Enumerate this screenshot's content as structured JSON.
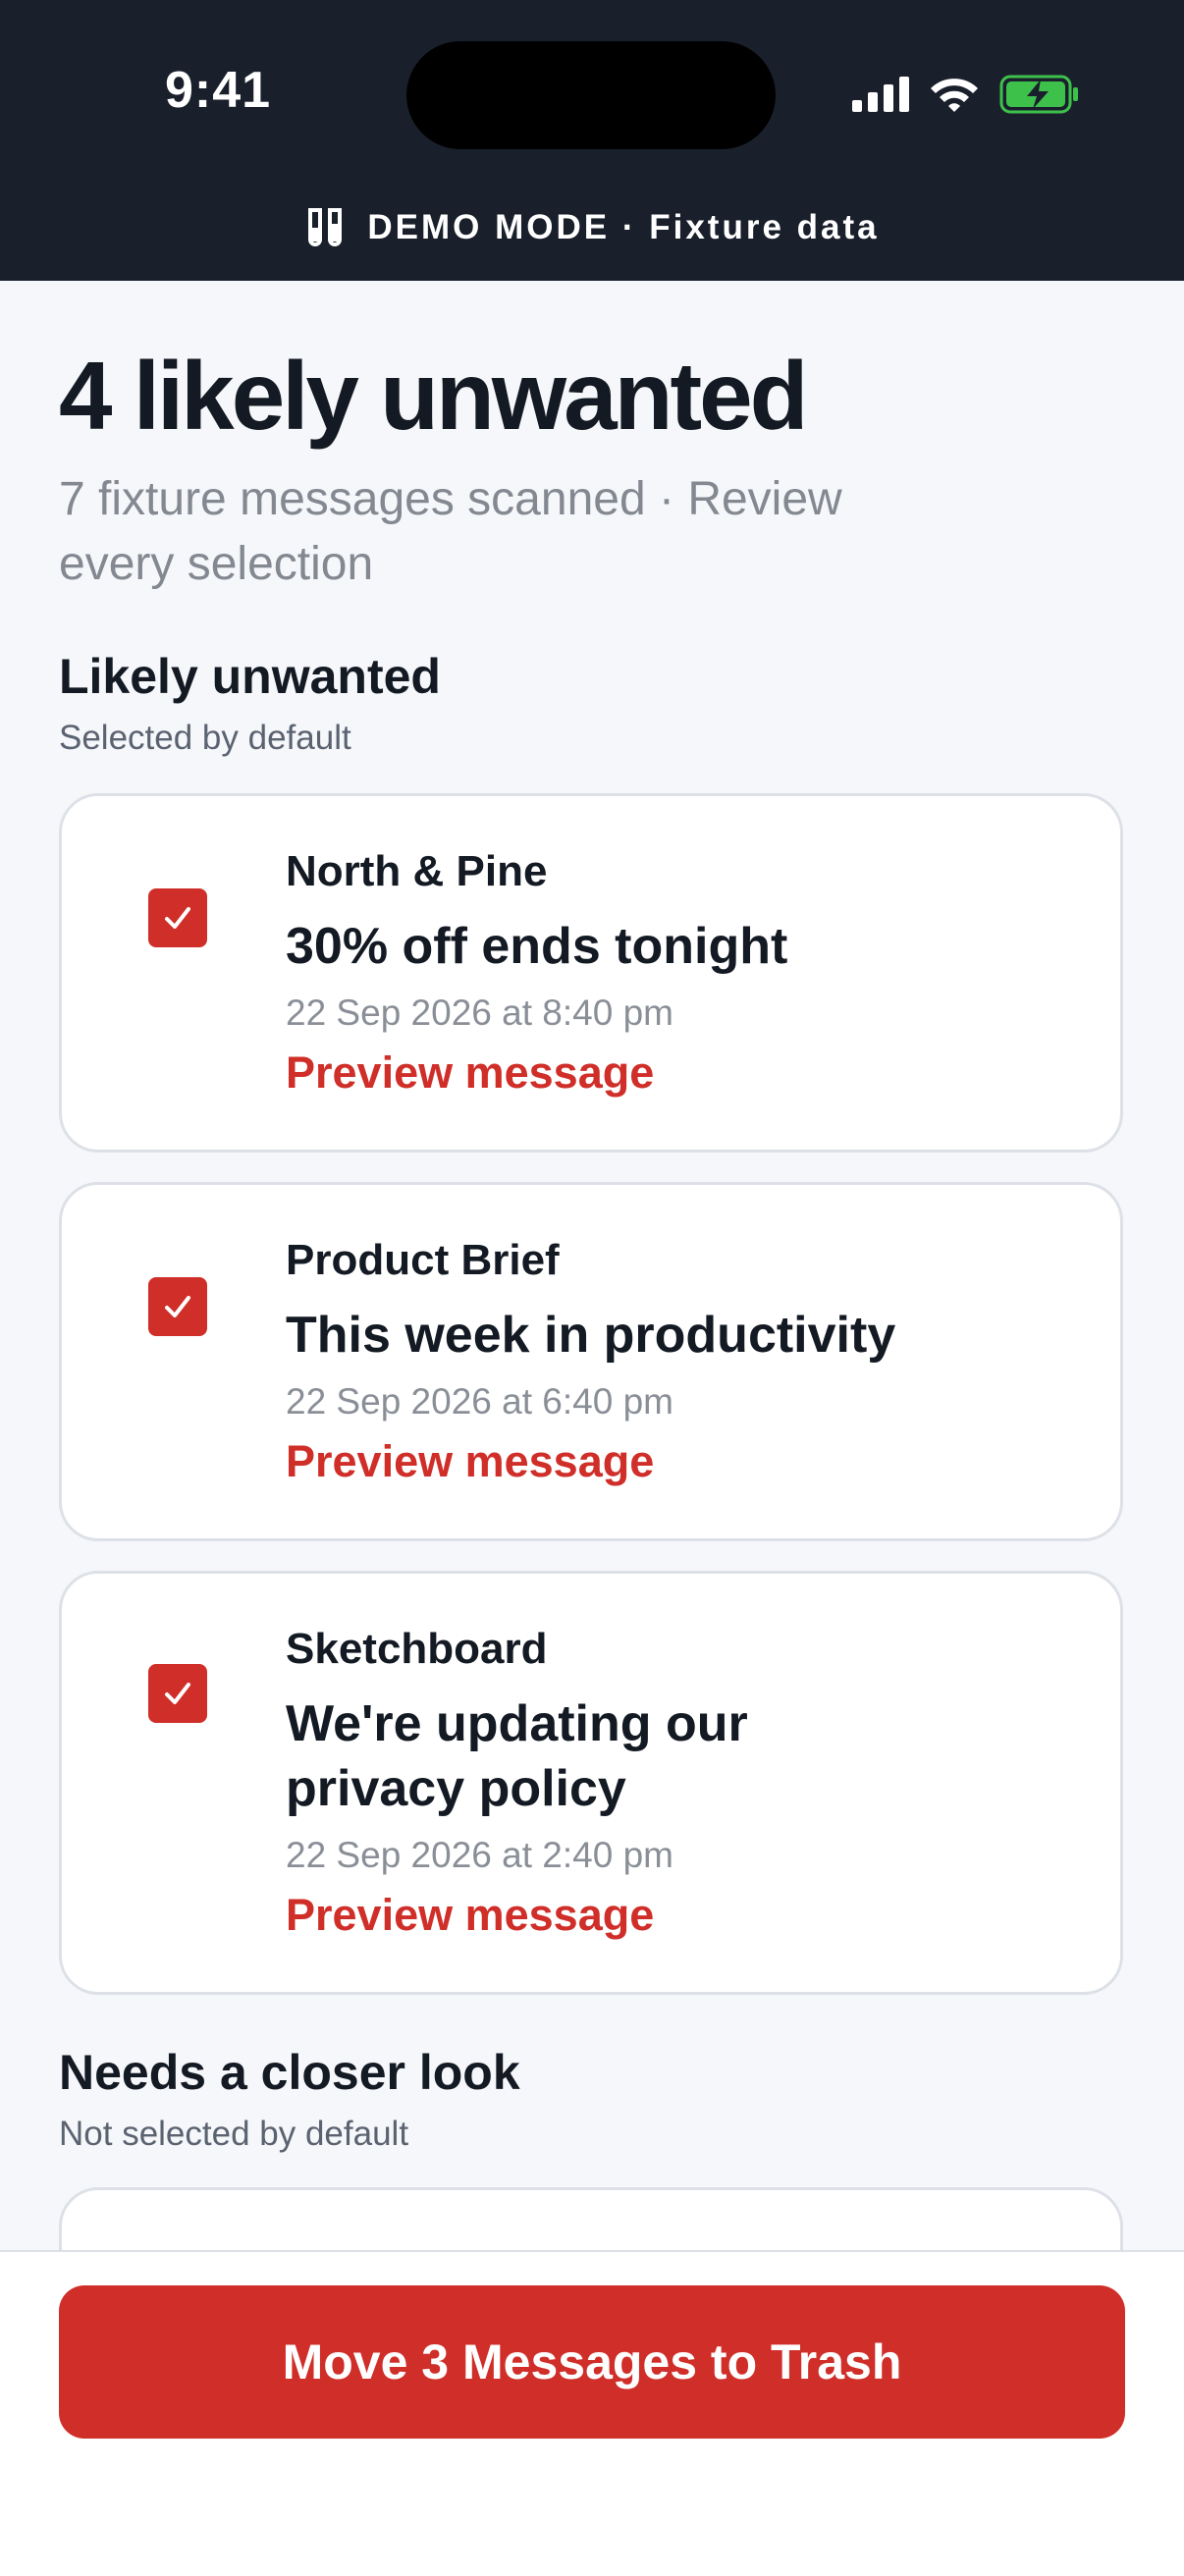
{
  "status_bar": {
    "time": "9:41",
    "icons": [
      "signal-icon",
      "wifi-icon",
      "battery-charging-icon"
    ]
  },
  "demo_banner": {
    "icon": "test-tubes-icon",
    "text": "DEMO MODE · Fixture data"
  },
  "header": {
    "title": "4 likely unwanted",
    "subtitle": "7 fixture messages scanned · Review every selection"
  },
  "sections": [
    {
      "title": "Likely unwanted",
      "subtitle": "Selected by default",
      "items": [
        {
          "sender": "North & Pine",
          "subject": "30% off ends tonight",
          "date": "22 Sep 2026 at 8:40 pm",
          "preview_label": "Preview message",
          "checked": true
        },
        {
          "sender": "Product Brief",
          "subject": "This week in productivity",
          "date": "22 Sep 2026 at 6:40 pm",
          "preview_label": "Preview message",
          "checked": true
        },
        {
          "sender": "Sketchboard",
          "subject": "We're updating our privacy policy",
          "date": "22 Sep 2026 at 2:40 pm",
          "preview_label": "Preview message",
          "checked": true
        }
      ]
    },
    {
      "title": "Needs a closer look",
      "subtitle": "Not selected by default"
    }
  ],
  "action": {
    "label": "Move 3 Messages to Trash"
  },
  "colors": {
    "accent": "#d02e28",
    "header_bg": "#19202c",
    "page_bg": "#f5f7fa",
    "battery": "#3ec14b"
  }
}
